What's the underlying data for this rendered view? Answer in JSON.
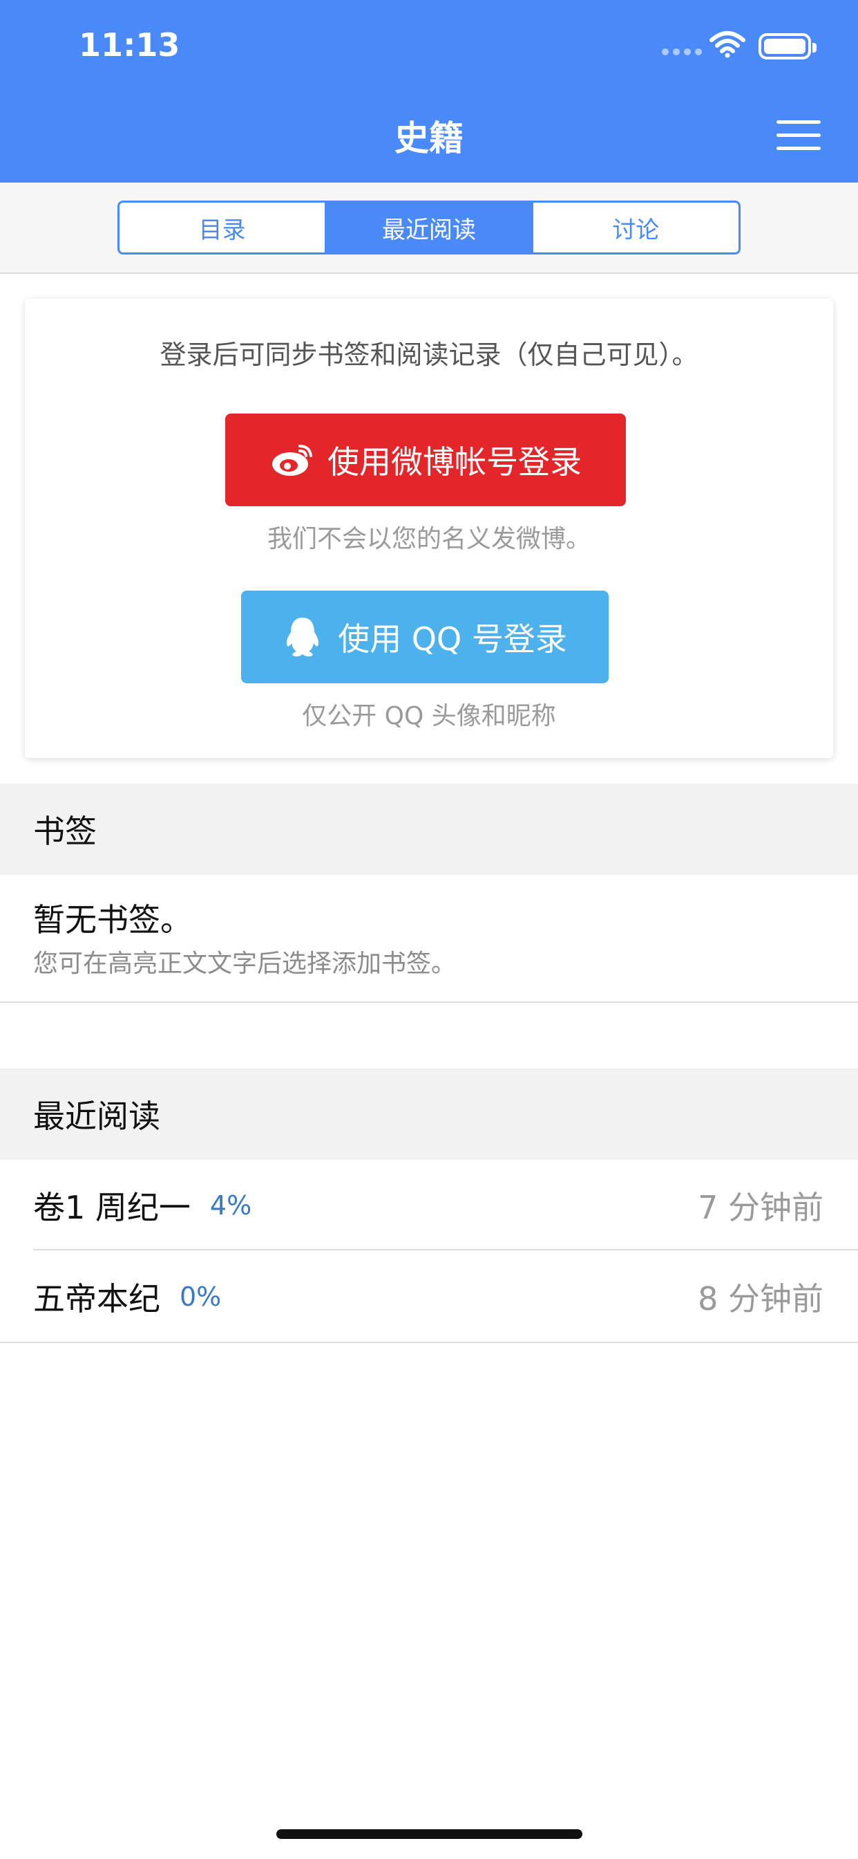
{
  "status": {
    "time": "11:13"
  },
  "header": {
    "title": "史籍"
  },
  "tabs": [
    {
      "label": "目录",
      "active": false
    },
    {
      "label": "最近阅读",
      "active": true
    },
    {
      "label": "讨论",
      "active": false
    }
  ],
  "login": {
    "note": "登录后可同步书签和阅读记录（仅自己可见）。",
    "weibo_label": "使用微博帐号登录",
    "weibo_note": "我们不会以您的名义发微博。",
    "qq_label": "使用 QQ 号登录",
    "qq_note": "仅公开 QQ 头像和昵称"
  },
  "bookmarks": {
    "header": "书签",
    "empty_title": "暂无书签。",
    "empty_sub": "您可在高亮正文文字后选择添加书签。"
  },
  "recent": {
    "header": "最近阅读",
    "items": [
      {
        "title": "卷1 周纪一",
        "progress": "4%",
        "time": "7 分钟前"
      },
      {
        "title": "五帝本纪",
        "progress": "0%",
        "time": "8 分钟前"
      }
    ]
  },
  "colors": {
    "brand": "#4a8af8",
    "weibo": "#e4262a",
    "qq": "#4db1ec",
    "progress": "#3a78c8"
  },
  "icons": [
    "wifi-icon",
    "battery-icon",
    "menu-icon",
    "weibo-icon",
    "qq-icon"
  ]
}
